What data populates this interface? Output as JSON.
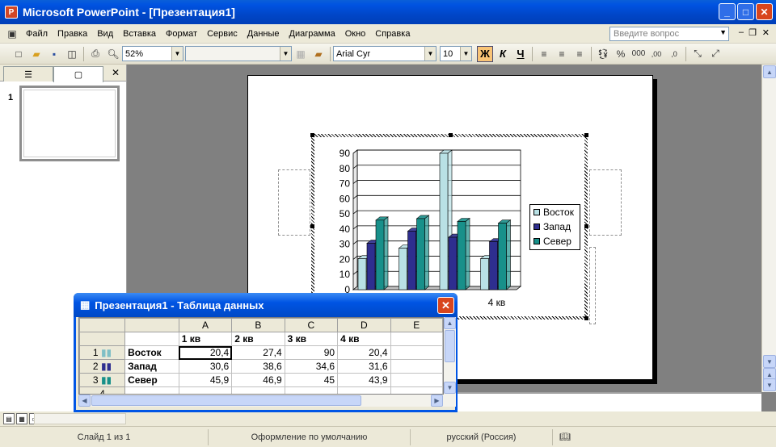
{
  "window": {
    "title": "Microsoft PowerPoint - [Презентация1]",
    "app_icon": "P"
  },
  "menu": {
    "items": [
      "Файл",
      "Правка",
      "Вид",
      "Вставка",
      "Формат",
      "Сервис",
      "Данные",
      "Диаграмма",
      "Окно",
      "Справка"
    ],
    "help_placeholder": "Введите вопрос"
  },
  "toolbar": {
    "zoom": "52%",
    "font": "Arial Cyr",
    "font_size": "10",
    "bold": "Ж",
    "italic": "К",
    "underline": "Ч"
  },
  "slides_pane": {
    "slide_number": "1"
  },
  "chart_data": {
    "type": "bar",
    "categories": [
      "1 кв",
      "2 кв",
      "3 кв",
      "4 кв"
    ],
    "series": [
      {
        "name": "Восток",
        "values": [
          20.4,
          27.4,
          90,
          20.4
        ],
        "color": "#b9e1e5"
      },
      {
        "name": "Запад",
        "values": [
          30.6,
          38.6,
          34.6,
          31.6
        ],
        "color": "#2e2e8f"
      },
      {
        "name": "Север",
        "values": [
          45.9,
          46.9,
          45,
          43.9
        ],
        "color": "#18908a"
      }
    ],
    "ylim": [
      0,
      90
    ],
    "yticks": [
      "0",
      "10",
      "20",
      "30",
      "40",
      "50",
      "60",
      "70",
      "80",
      "90"
    ],
    "visible_category_label": "4 кв",
    "grid": true,
    "legend": "right"
  },
  "datasheet": {
    "title": "Презентация1 - Таблица данных",
    "col_letters": [
      "A",
      "B",
      "C",
      "D",
      "E"
    ],
    "col_headers": [
      "1 кв",
      "2 кв",
      "3 кв",
      "4 кв",
      ""
    ],
    "rows": [
      {
        "num": "1",
        "label": "Восток",
        "values": [
          "20,4",
          "27,4",
          "90",
          "20,4"
        ]
      },
      {
        "num": "2",
        "label": "Запад",
        "values": [
          "30,6",
          "38,6",
          "34,6",
          "31,6"
        ]
      },
      {
        "num": "3",
        "label": "Север",
        "values": [
          "45,9",
          "46,9",
          "45",
          "43,9"
        ]
      },
      {
        "num": "4",
        "label": "",
        "values": [
          "",
          "",
          "",
          ""
        ]
      }
    ]
  },
  "status": {
    "slide": "Слайд 1 из 1",
    "design": "Оформление по умолчанию",
    "language": "русский (Россия)"
  }
}
